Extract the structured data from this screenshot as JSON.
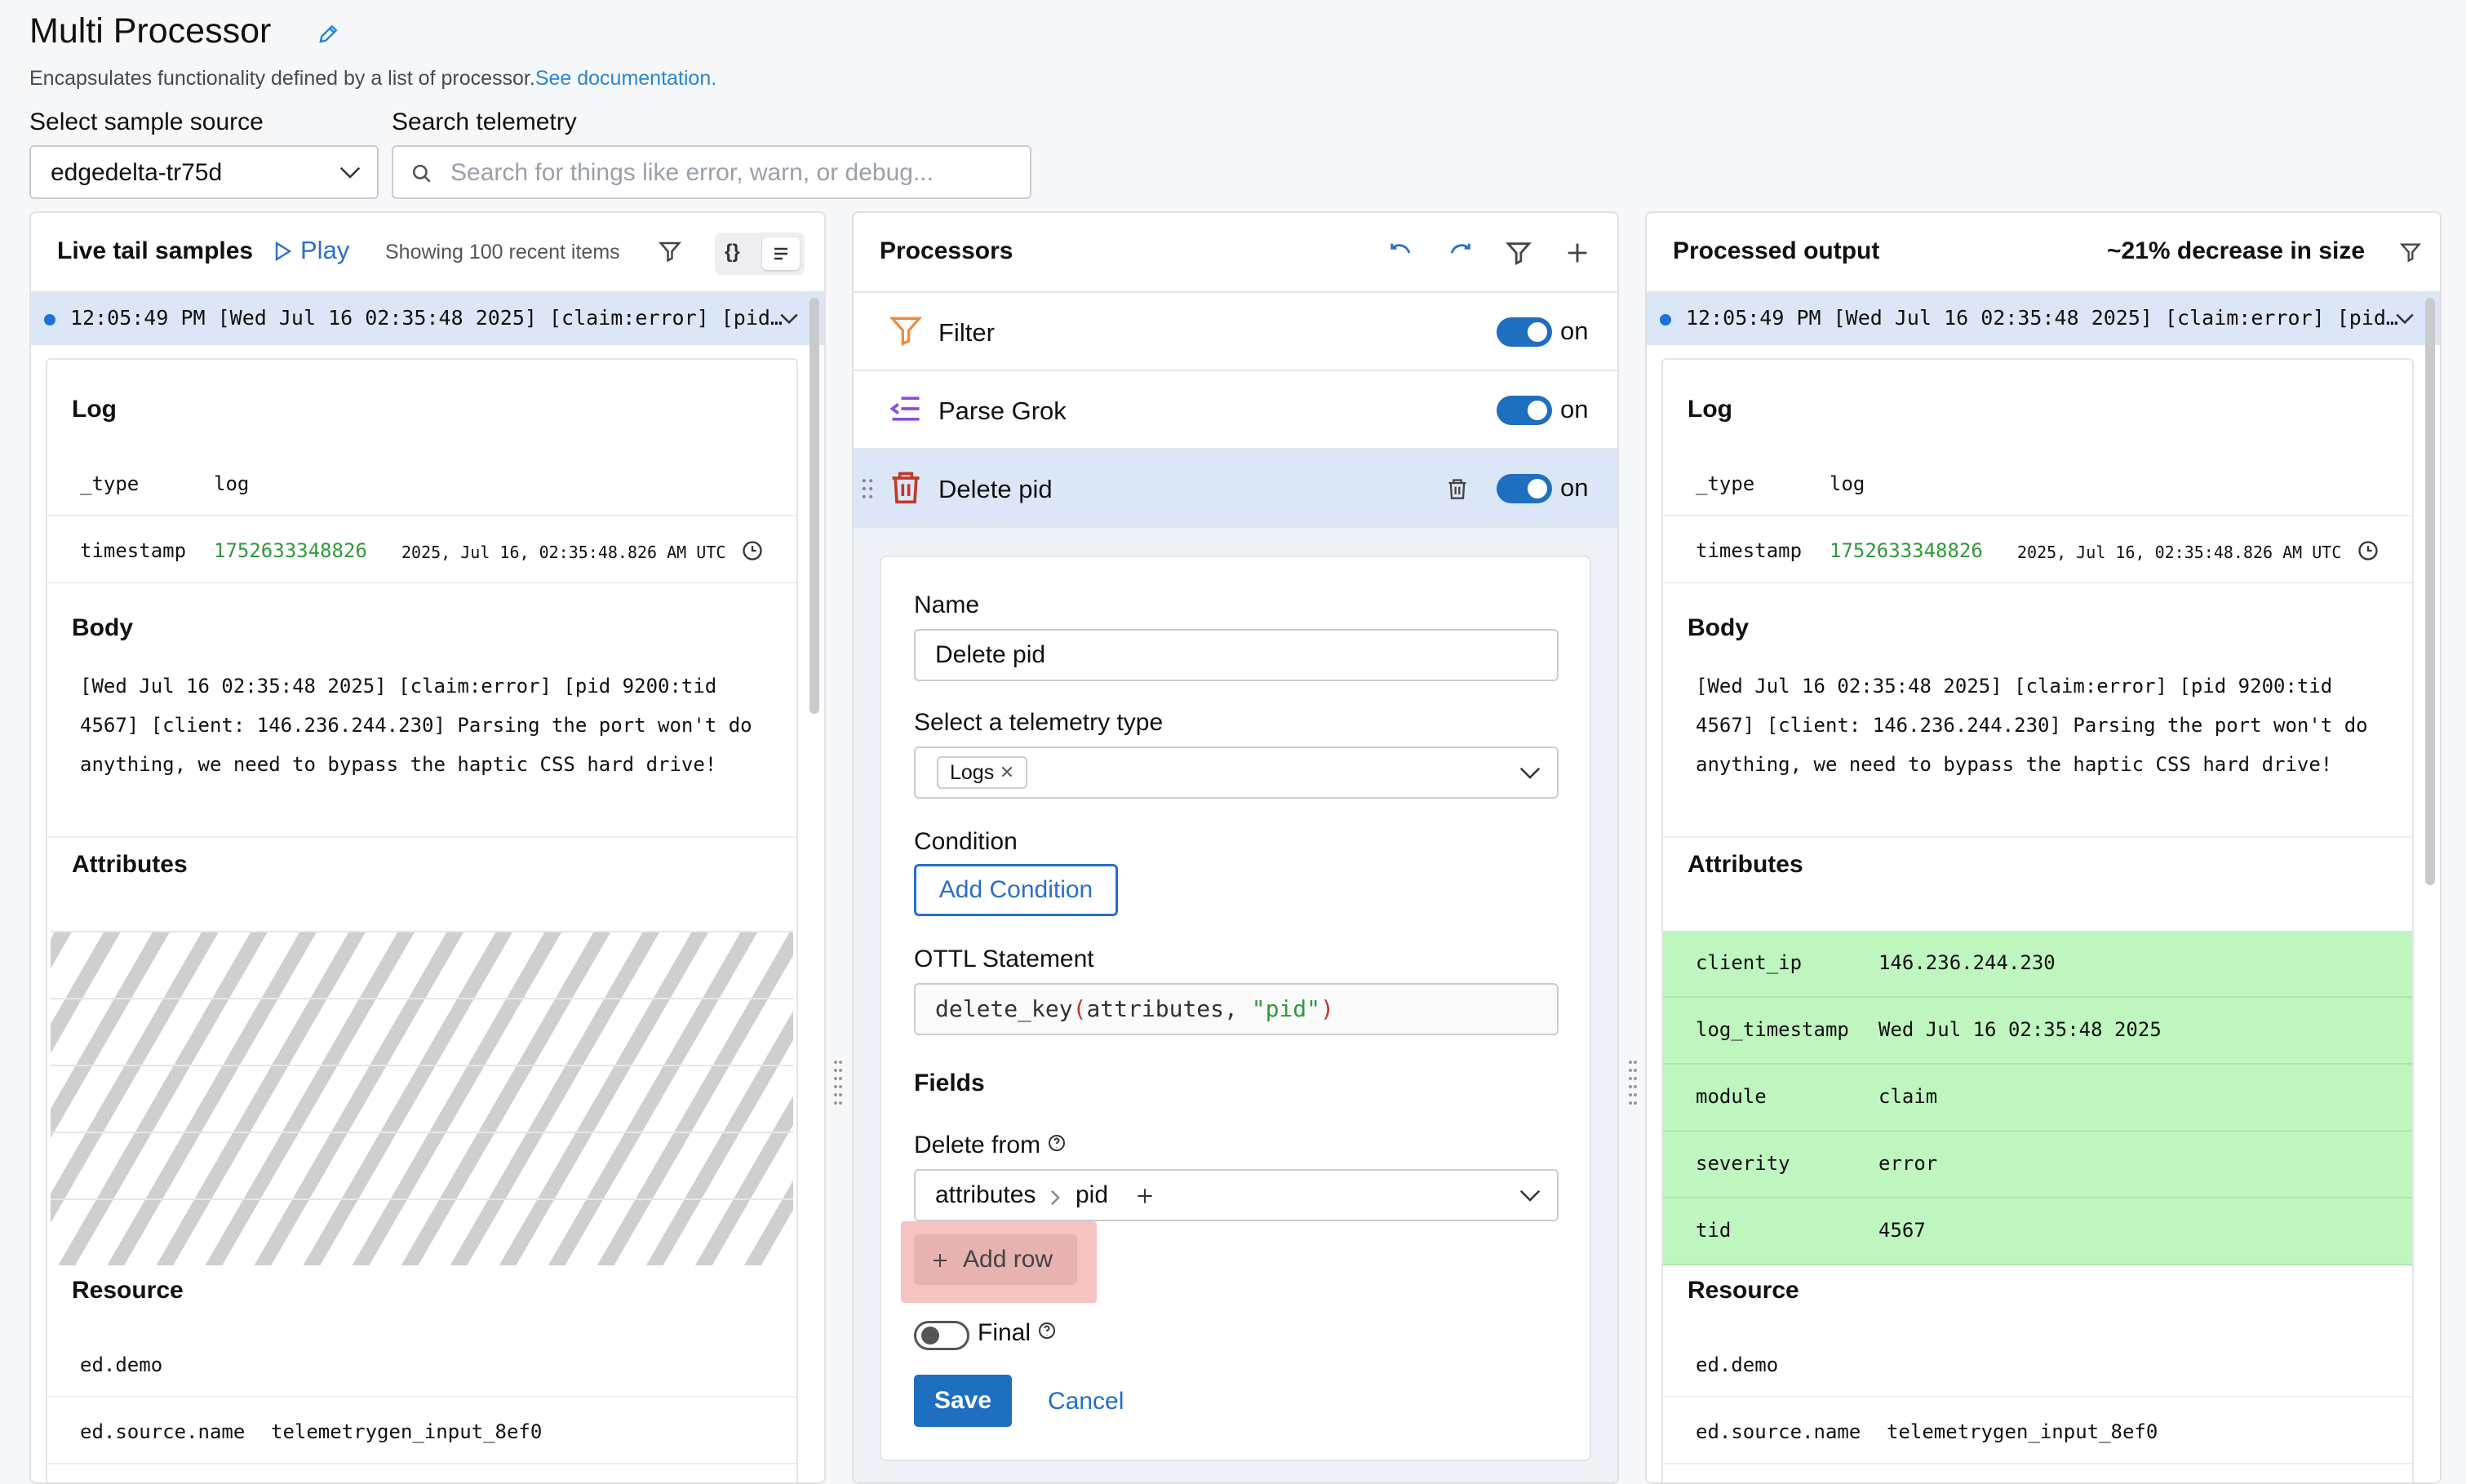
{
  "header": {
    "title": "Multi Processor",
    "description": "Encapsulates functionality defined by a list of processor.",
    "doc_link": "See documentation.",
    "source_label": "Select sample source",
    "source_value": "edgedelta-tr75d",
    "search_label": "Search telemetry",
    "search_placeholder": "Search for things like error, warn, or debug..."
  },
  "left_panel": {
    "title": "Live tail samples",
    "play": "Play",
    "showing": "Showing 100 recent items",
    "view_json": "{}",
    "row": "12:05:49 PM [Wed Jul 16 02:35:48 2025] [claim:error] [pid…",
    "log_title": "Log",
    "type_key": "_type",
    "type_val": "log",
    "ts_key": "timestamp",
    "ts_val": "1752633348826",
    "ts_date": "2025, Jul 16, 02:35:48.826 AM UTC",
    "body_title": "Body",
    "body_text": "[Wed Jul 16 02:35:48 2025] [claim:error] [pid 9200:tid 4567] [client: 146.236.244.230] Parsing the port won't do anything, we need to bypass the haptic CSS hard drive!",
    "attributes_title": "Attributes",
    "resource_title": "Resource",
    "res1": "ed.demo",
    "res2_key": "ed.source.name",
    "res2_val": "telemetrygen_input_8ef0"
  },
  "processors": {
    "title": "Processors",
    "items": [
      {
        "name": "Filter",
        "state": "on"
      },
      {
        "name": "Parse Grok",
        "state": "on"
      },
      {
        "name": "Delete pid",
        "state": "on"
      }
    ],
    "form": {
      "name_label": "Name",
      "name_value": "Delete pid",
      "telemetry_label": "Select a telemetry type",
      "telemetry_chip": "Logs",
      "condition_label": "Condition",
      "add_condition": "Add Condition",
      "ottl_label": "OTTL Statement",
      "ottl_fn": "delete_key",
      "ottl_open": "(",
      "ottl_arg": "attributes, ",
      "ottl_str": "\"pid\"",
      "ottl_close": ")",
      "fields_label": "Fields",
      "delete_from_label": "Delete from",
      "path_1": "attributes",
      "path_2": "pid",
      "add_row": "Add row",
      "final_label": "Final",
      "save": "Save",
      "cancel": "Cancel"
    }
  },
  "right_panel": {
    "title": "Processed output",
    "decrease": "~21% decrease in size",
    "row": "12:05:49 PM [Wed Jul 16 02:35:48 2025] [claim:error] [pid…",
    "log_title": "Log",
    "type_key": "_type",
    "type_val": "log",
    "ts_key": "timestamp",
    "ts_val": "1752633348826",
    "ts_date": "2025, Jul 16, 02:35:48.826 AM UTC",
    "body_title": "Body",
    "body_text": "[Wed Jul 16 02:35:48 2025] [claim:error] [pid 9200:tid 4567] [client: 146.236.244.230] Parsing the port won't do anything, we need to bypass the haptic CSS hard drive!",
    "attributes_title": "Attributes",
    "attributes": [
      {
        "key": "client_ip",
        "value": "146.236.244.230"
      },
      {
        "key": "log_timestamp",
        "value": "Wed Jul 16 02:35:48 2025"
      },
      {
        "key": "module",
        "value": "claim"
      },
      {
        "key": "severity",
        "value": "error"
      },
      {
        "key": "tid",
        "value": "4567"
      }
    ],
    "resource_title": "Resource",
    "res1": "ed.demo",
    "res2_key": "ed.source.name",
    "res2_val": "telemetrygen_input_8ef0"
  },
  "colors": {
    "accent": "#1f6fc0",
    "selected_row": "#dbe7f7",
    "added_attr": "#bff5bf",
    "number_green": "#2f9a3a"
  }
}
